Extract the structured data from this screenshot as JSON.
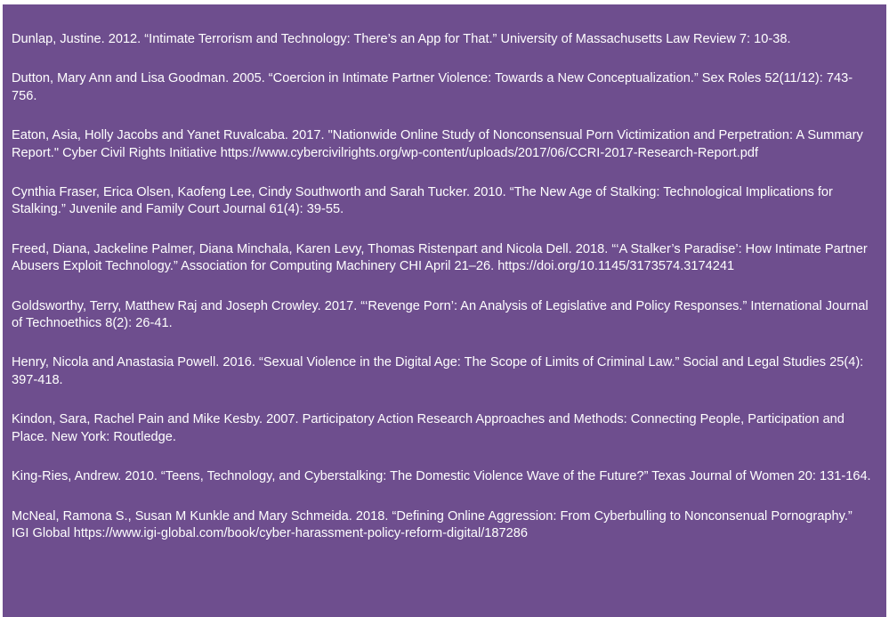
{
  "references": [
    "Dunlap, Justine. 2012. “Intimate Terrorism and Technology: There’s an App for That.” University of Massachusetts Law Review 7: 10-38.",
    "Dutton, Mary Ann and Lisa Goodman. 2005. “Coercion in Intimate Partner Violence: Towards a New Conceptualization.” Sex Roles 52(11/12): 743-756.",
    "Eaton, Asia, Holly Jacobs and Yanet Ruvalcaba. 2017. \"Nationwide Online Study of Nonconsensual Porn Victimization and Perpetration: A Summary Report.\" Cyber Civil Rights Initiative https://www.cybercivilrights.org/wp-content/uploads/2017/06/CCRI-2017-Research-Report.pdf",
    "Cynthia Fraser, Erica Olsen, Kaofeng Lee, Cindy Southworth and Sarah Tucker. 2010. “The New Age of Stalking: Technological Implications for Stalking.” Juvenile and Family Court Journal 61(4): 39-55.",
    "Freed, Diana, Jackeline Palmer, Diana Minchala, Karen Levy, Thomas Ristenpart and Nicola Dell. 2018. “‘A Stalker’s Paradise’: How Intimate Partner Abusers Exploit Technology.” Association for Computing Machinery CHI April 21–26. https://doi.org/10.1145/3173574.3174241",
    "Goldsworthy, Terry, Matthew Raj and Joseph Crowley. 2017. “‘Revenge Porn’: An Analysis of Legislative and Policy Responses.” International Journal of Technoethics 8(2): 26-41.",
    "Henry, Nicola and Anastasia Powell. 2016. “Sexual Violence in the Digital Age: The Scope of Limits of Criminal Law.” Social and Legal Studies 25(4): 397-418.",
    "Kindon, Sara, Rachel Pain and Mike Kesby. 2007. Participatory Action Research Approaches and Methods: Connecting People, Participation and Place. New York: Routledge.",
    "King-Ries, Andrew. 2010. “Teens, Technology, and Cyberstalking: The Domestic Violence Wave of the Future?” Texas Journal of Women 20: 131-164.",
    "McNeal, Ramona S., Susan M Kunkle and Mary Schmeida. 2018. “Defining Online Aggression: From Cyberbulling to Nonconsenual Pornography.” IGI Global https://www.igi-global.com/book/cyber-harassment-policy-reform-digital/187286"
  ]
}
